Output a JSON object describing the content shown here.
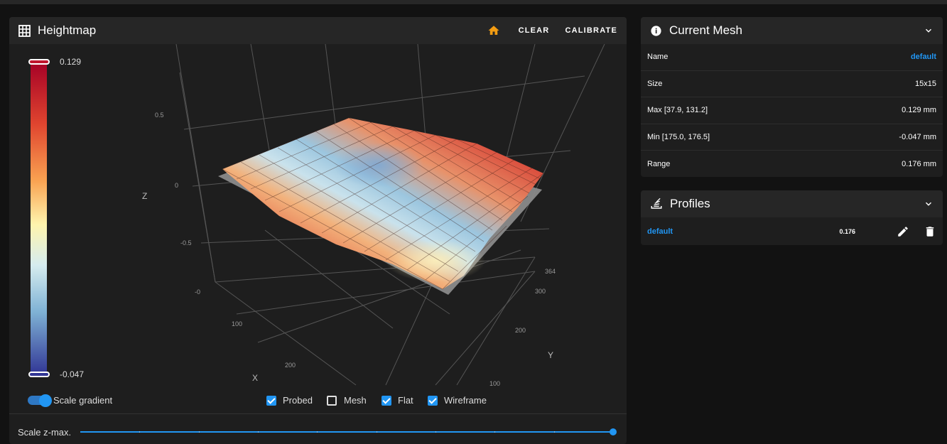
{
  "heightmap": {
    "title": "Heightmap",
    "clear_label": "CLEAR",
    "calibrate_label": "CALIBRATE",
    "scale_max": "0.129",
    "scale_min": "-0.047",
    "axis_z": "Z",
    "axis_x": "X",
    "axis_y": "Y",
    "z_ticks": [
      "0.5",
      "0",
      "-0.5",
      "-0"
    ],
    "x_ticks": [
      "100",
      "200"
    ],
    "y_ticks": [
      "364",
      "300",
      "200",
      "100"
    ],
    "controls": {
      "scale_gradient": "Scale gradient",
      "probed": "Probed",
      "mesh": "Mesh",
      "flat": "Flat",
      "wireframe": "Wireframe"
    },
    "states": {
      "scale_gradient": true,
      "probed": true,
      "mesh": false,
      "flat": true,
      "wireframe": true
    },
    "scale_zmax_label": "Scale z-max.",
    "scale_zmax_fraction": 1.0
  },
  "current_mesh": {
    "title": "Current Mesh",
    "rows": [
      {
        "label": "Name",
        "value": "default"
      },
      {
        "label": "Size",
        "value": "15x15"
      },
      {
        "label": "Max [37.9, 131.2]",
        "value": "0.129 mm"
      },
      {
        "label": "Min [175.0, 176.5]",
        "value": "-0.047 mm"
      },
      {
        "label": "Range",
        "value": "0.176 mm"
      }
    ]
  },
  "profiles": {
    "title": "Profiles",
    "items": [
      {
        "name": "default",
        "value": "0.176"
      }
    ]
  },
  "colors": {
    "accent": "#2196f3",
    "home_icon": "#f39c12",
    "scale_top": "#b2182b",
    "scale_mid": "#ffffbf",
    "scale_bottom": "#313695"
  },
  "icons": {
    "heightmap": "grid-icon",
    "home": "home-icon",
    "current_mesh": "info-icon",
    "profiles": "layers-icon",
    "edit": "pencil-icon",
    "delete": "trash-icon",
    "collapse": "chevron-down-icon"
  }
}
